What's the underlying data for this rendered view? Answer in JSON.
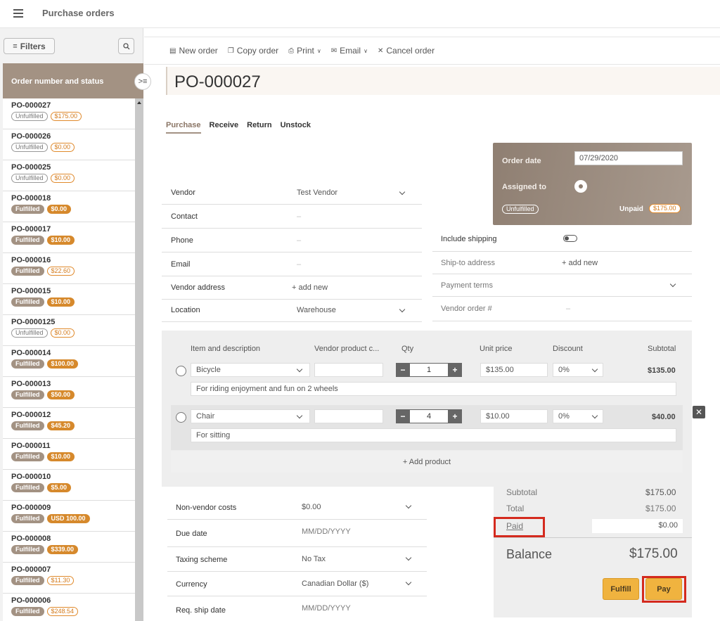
{
  "app": {
    "title": "Purchase orders"
  },
  "left": {
    "filters_label": "Filters",
    "list_header": "Order number and status",
    "orders": [
      {
        "number": "PO-000027",
        "status": "Unfulfilled",
        "amount": "$175.00",
        "fulfilled": false
      },
      {
        "number": "PO-000026",
        "status": "Unfulfilled",
        "amount": "$0.00",
        "fulfilled": false
      },
      {
        "number": "PO-000025",
        "status": "Unfulfilled",
        "amount": "$0.00",
        "fulfilled": false
      },
      {
        "number": "PO-000018",
        "status": "Fulfilled",
        "amount": "$0.00",
        "fulfilled": true,
        "amount_filled": true
      },
      {
        "number": "PO-000017",
        "status": "Fulfilled",
        "amount": "$10.00",
        "fulfilled": true,
        "amount_filled": true
      },
      {
        "number": "PO-000016",
        "status": "Fulfilled",
        "amount": "$22.60",
        "fulfilled": true,
        "amount_filled": false
      },
      {
        "number": "PO-000015",
        "status": "Fulfilled",
        "amount": "$10.00",
        "fulfilled": true,
        "amount_filled": true
      },
      {
        "number": "PO-0000125",
        "status": "Unfulfilled",
        "amount": "$0.00",
        "fulfilled": false
      },
      {
        "number": "PO-000014",
        "status": "Fulfilled",
        "amount": "$100.00",
        "fulfilled": true,
        "amount_filled": true
      },
      {
        "number": "PO-000013",
        "status": "Fulfilled",
        "amount": "$50.00",
        "fulfilled": true,
        "amount_filled": true
      },
      {
        "number": "PO-000012",
        "status": "Fulfilled",
        "amount": "$45.20",
        "fulfilled": true,
        "amount_filled": true
      },
      {
        "number": "PO-000011",
        "status": "Fulfilled",
        "amount": "$10.00",
        "fulfilled": true,
        "amount_filled": true
      },
      {
        "number": "PO-000010",
        "status": "Fulfilled",
        "amount": "$5.00",
        "fulfilled": true,
        "amount_filled": true
      },
      {
        "number": "PO-000009",
        "status": "Fulfilled",
        "amount": "USD 100.00",
        "fulfilled": true,
        "amount_filled": true
      },
      {
        "number": "PO-000008",
        "status": "Fulfilled",
        "amount": "$339.00",
        "fulfilled": true,
        "amount_filled": true
      },
      {
        "number": "PO-000007",
        "status": "Fulfilled",
        "amount": "$11.30",
        "fulfilled": true,
        "amount_filled": false
      },
      {
        "number": "PO-000006",
        "status": "Fulfilled",
        "amount": "$248.54",
        "fulfilled": true,
        "amount_filled": false
      }
    ]
  },
  "toolbar": {
    "new_order": "New order",
    "copy_order": "Copy order",
    "print": "Print",
    "email": "Email",
    "cancel_order": "Cancel order"
  },
  "order": {
    "number": "PO-000027",
    "tabs": [
      "Purchase",
      "Receive",
      "Return",
      "Unstock"
    ],
    "active_tab": "Purchase"
  },
  "vendor_form": {
    "vendor_label": "Vendor",
    "vendor_value": "Test Vendor",
    "contact_label": "Contact",
    "contact_value": "–",
    "phone_label": "Phone",
    "phone_value": "–",
    "email_label": "Email",
    "email_value": "–",
    "address_label": "Vendor address",
    "address_value": "+ add new",
    "location_label": "Location",
    "location_value": "Warehouse"
  },
  "order_box": {
    "date_label": "Order date",
    "date_value": "07/29/2020",
    "assigned_label": "Assigned to",
    "status_badge": "Unfulfilled",
    "payment_status": "Unpaid",
    "amount_badge": "$175.00"
  },
  "shipping_form": {
    "include_shipping_label": "Include shipping",
    "ship_to_label": "Ship-to address",
    "ship_to_value": "+ add new",
    "payment_terms_label": "Payment terms",
    "vendor_order_label": "Vendor order #",
    "vendor_order_value": "–"
  },
  "items": {
    "headers": {
      "item": "Item and description",
      "vendor_code": "Vendor product c...",
      "qty": "Qty",
      "unit_price": "Unit price",
      "discount": "Discount",
      "subtotal": "Subtotal"
    },
    "rows": [
      {
        "name": "Bicycle",
        "vendor_code": "",
        "qty": "1",
        "unit_price": "$135.00",
        "discount": "0%",
        "subtotal": "$135.00",
        "description": "For riding enjoyment and fun on 2 wheels"
      },
      {
        "name": "Chair",
        "vendor_code": "",
        "qty": "4",
        "unit_price": "$10.00",
        "discount": "0%",
        "subtotal": "$40.00",
        "description": "For sitting"
      }
    ],
    "add_product": "+ Add product",
    "remove_glyph": "✕"
  },
  "lower_form": {
    "non_vendor_label": "Non-vendor costs",
    "non_vendor_value": "$0.00",
    "due_date_label": "Due date",
    "due_date_placeholder": "MM/DD/YYYY",
    "taxing_label": "Taxing scheme",
    "taxing_value": "No Tax",
    "currency_label": "Currency",
    "currency_value": "Canadian Dollar ($)",
    "req_ship_label": "Req. ship date",
    "req_ship_placeholder": "MM/DD/YYYY"
  },
  "totals": {
    "subtotal_label": "Subtotal",
    "subtotal_value": "$175.00",
    "total_label": "Total",
    "total_value": "$175.00",
    "paid_label": "Paid",
    "paid_value": "$0.00",
    "balance_label": "Balance",
    "balance_value": "$175.00",
    "fulfill_button": "Fulfill",
    "pay_button": "Pay"
  },
  "colors": {
    "accent": "#a39283",
    "orange": "#d6892c",
    "button": "#f0b33f",
    "highlight": "#d42a1e"
  }
}
